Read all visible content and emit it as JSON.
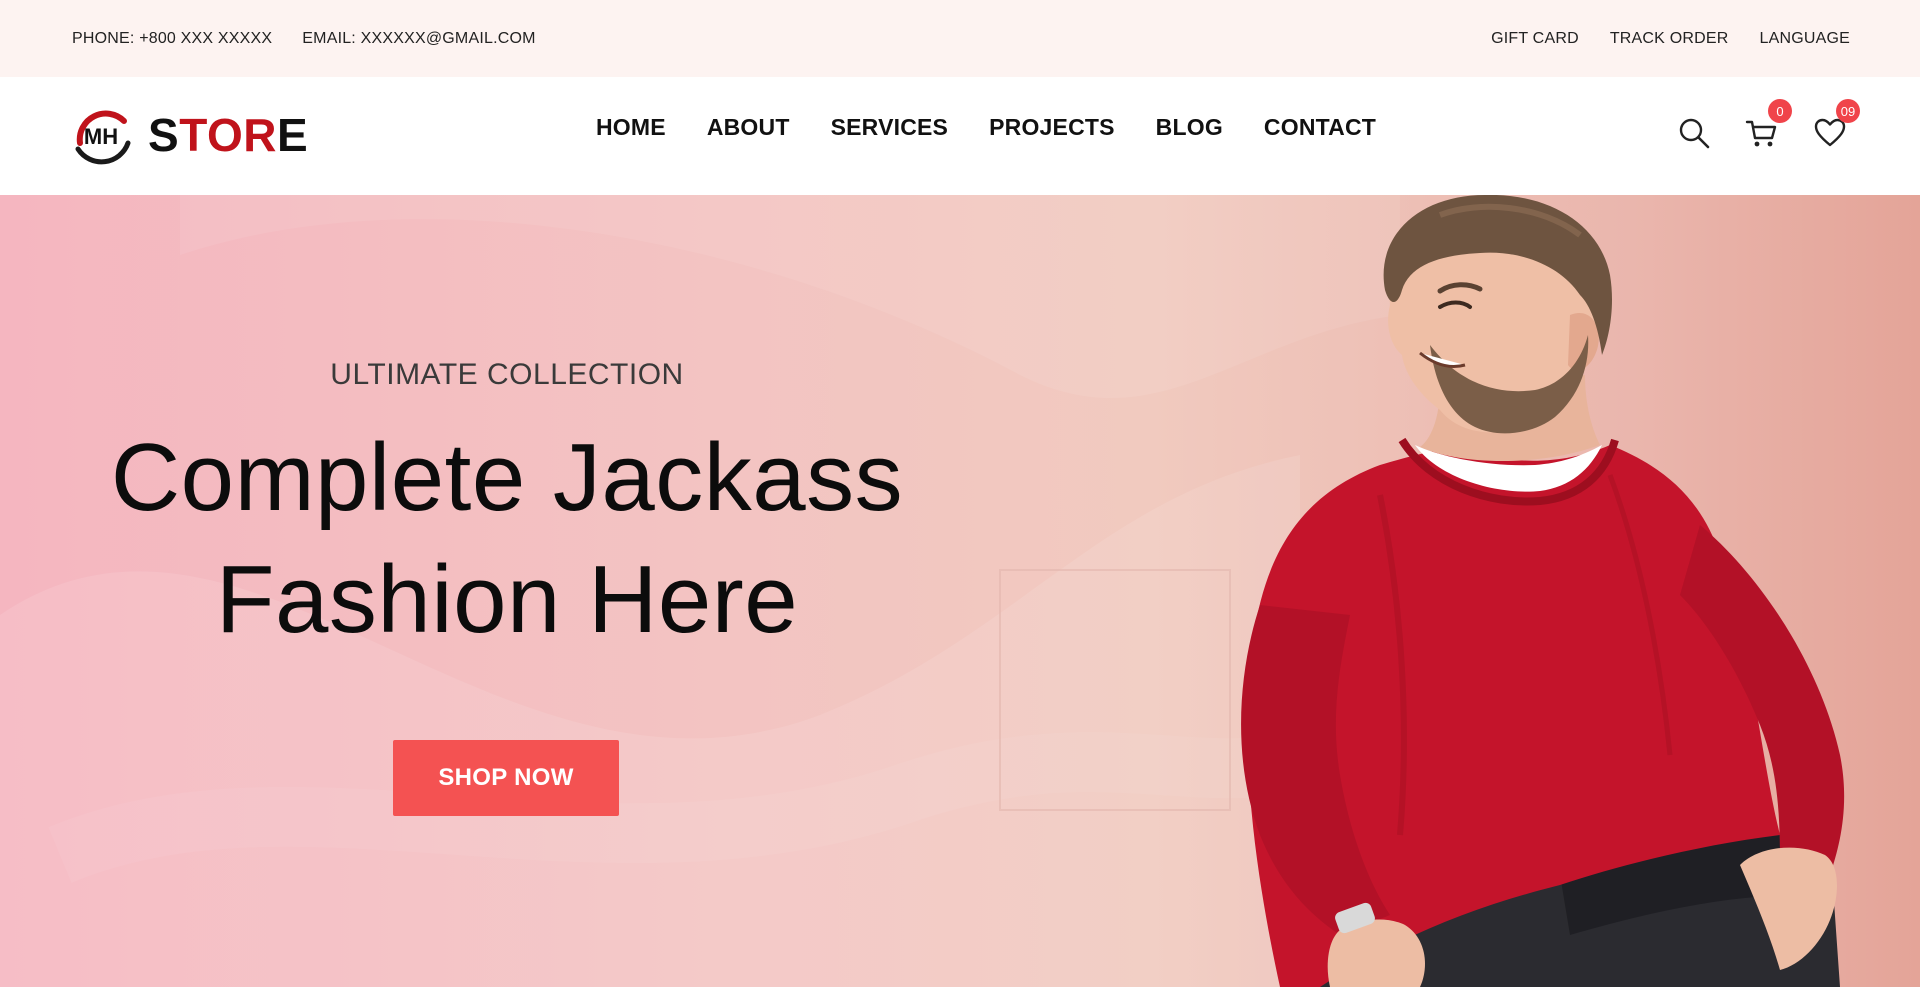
{
  "topbar": {
    "phone": "PHONE: +800 XXX XXXXX",
    "email": "EMAIL: XXXXXX@GMAIL.COM",
    "links": [
      "GIFT CARD",
      "TRACK ORDER",
      "LANGUAGE"
    ]
  },
  "header": {
    "logo_letters": "MH",
    "brand_part1": "S",
    "brand_part2": "TOR",
    "brand_part3": "E",
    "nav": [
      "HOME",
      "ABOUT",
      "SERVICES",
      "PROJECTS",
      "BLOG",
      "CONTACT"
    ],
    "cart_count": "0",
    "wishlist_count": "09",
    "icons": [
      "search-icon",
      "cart-icon",
      "heart-icon"
    ]
  },
  "hero": {
    "eyebrow": "ULTIMATE COLLECTION",
    "headline_line1": "Complete Jackass",
    "headline_line2": "Fashion Here",
    "cta_label": "SHOP NOW"
  },
  "colors": {
    "accent": "#f45252",
    "brand_red": "#c0131b",
    "badge": "#f0444a",
    "topbar_bg": "#fdf3f1",
    "sweater": "#c4142b"
  }
}
